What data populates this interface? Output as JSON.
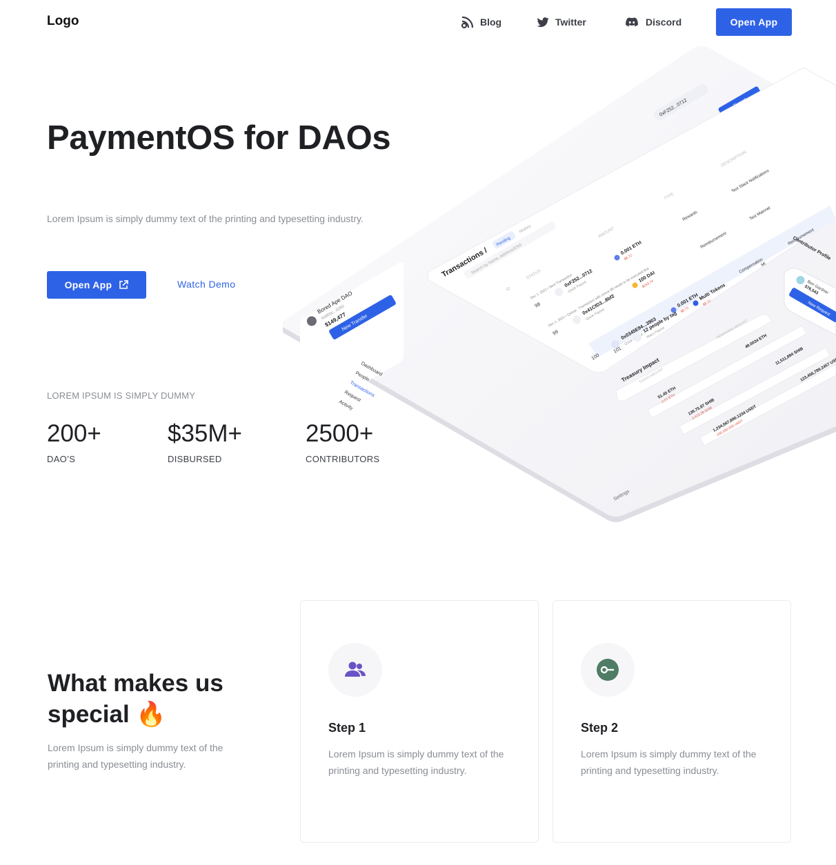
{
  "nav": {
    "logo": "Logo",
    "blog": "Blog",
    "twitter": "Twitter",
    "discord": "Discord",
    "cta": "Open App"
  },
  "hero": {
    "title": "PaymentOS for DAOs",
    "subtitle": "Lorem Ipsum is simply dummy text of the printing and typesetting industry.",
    "cta": "Open App",
    "demo": "Watch Demo"
  },
  "stats": {
    "label": "LOREM IPSUM IS SIMPLY DUMMY",
    "items": [
      {
        "value": "200+",
        "label": "DAO’S"
      },
      {
        "value": "$35M+",
        "label": "DISBURSED"
      },
      {
        "value": "2500+",
        "label": "CONTRIBUTORS"
      }
    ]
  },
  "mockup": {
    "wallet": "0xF252...0712",
    "export": "Export",
    "dao_name": "Bored Ape DAO",
    "dao_addr": "0x90bc...0260",
    "dao_balance": "$149,477",
    "new_transfer": "New Transfer",
    "sidebar": [
      "Dashboard",
      "People",
      "Transactions",
      "Request",
      "Activity"
    ],
    "settings": "Settings",
    "tx_title": "Transactions /",
    "tab_pending": "Pending",
    "tab_history": "History",
    "search_placeholder": "Search by Name, Address/ENS",
    "columns": [
      "ID",
      "STATUS",
      "AMOUNT",
      "TYPE",
      "DESCRIPTION"
    ],
    "rows": [
      {
        "id": "98",
        "date": "Dec 1, 2021 • Next Transaction",
        "to": "0xF252...0712",
        "sub": "Quick Payout",
        "amount": "0.001 ETH",
        "usd": "$8.72",
        "type": "Rewards",
        "desc": "Test Slack Notifications"
      },
      {
        "id": "99",
        "date": "Dec 1, 2021 • Queue : Transaction with nonce 98 needs to be executed first",
        "to": "0x41CfD3...8bf2",
        "sub": "Quick Payout",
        "amount": "100 DAI",
        "usd": "$243.74",
        "type": "Reimbursement",
        "desc": "Test Mainnet"
      },
      {
        "id": "100",
        "date": "",
        "to": "0x0345E94...3903",
        "sub": "Quick Payout",
        "amount": "0.001 ETH",
        "usd": "$8.72",
        "type": "Compensation",
        "desc": "Reimbursement"
      },
      {
        "id": "101",
        "date": "",
        "to": "12 people by tag",
        "sub": "Mass Payout",
        "amount": "Multi Tokens",
        "usd": "$8.72",
        "type": "Mi",
        "desc": ""
      }
    ],
    "treasury_title": "Treasury Impact",
    "treasury_cols": [
      "TOKEN AMOUNT",
      "REMAINING AMOUNT"
    ],
    "treasury_rows": [
      {
        "amt": "51.45 ETH",
        "chg": "-2.07 ETH",
        "rem": "49.0034 ETH"
      },
      {
        "amt": "136.75.87 SHIB",
        "chg": "-2,415.28 SHIB",
        "rem": "11,511,894 SHIB"
      },
      {
        "amt": "1,234,567,890.1234 USDT",
        "chg": "-200,000.000 USDT",
        "rem": "123,456,789.2457 USDT"
      }
    ],
    "profile_title": "Contributor Profile",
    "profile_name": "Ben Gardner",
    "profile_amt": "$76,543",
    "profile_btn": "New Request"
  },
  "features": {
    "title": "What makes us special 🔥",
    "subtitle": "Lorem Ipsum is simply dummy text of the printing and typesetting industry.",
    "cards": [
      {
        "title": "Step 1",
        "desc": "Lorem Ipsum is simply dummy text of the printing and typesetting industry.",
        "icon": "people-icon"
      },
      {
        "title": "Step 2",
        "desc": "Lorem Ipsum is simply dummy text of the printing and typesetting industry.",
        "icon": "key-icon"
      }
    ]
  },
  "colors": {
    "primary": "#2e62e6",
    "icon_purple": "#6a53c6",
    "icon_green": "#4f7c64"
  }
}
